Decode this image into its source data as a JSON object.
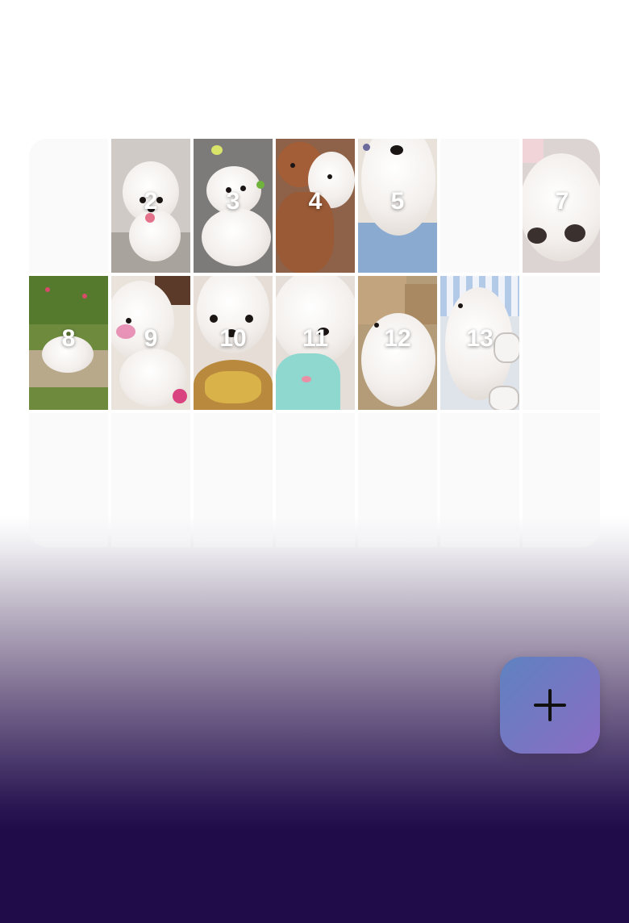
{
  "tiles": [
    {
      "label": "",
      "filled": false
    },
    {
      "label": "2",
      "filled": true
    },
    {
      "label": "3",
      "filled": true
    },
    {
      "label": "4",
      "filled": true
    },
    {
      "label": "5",
      "filled": true
    },
    {
      "label": "",
      "filled": false
    },
    {
      "label": "7",
      "filled": true
    },
    {
      "label": "8",
      "filled": true
    },
    {
      "label": "9",
      "filled": true
    },
    {
      "label": "10",
      "filled": true
    },
    {
      "label": "11",
      "filled": true
    },
    {
      "label": "12",
      "filled": true
    },
    {
      "label": "13",
      "filled": true
    },
    {
      "label": "",
      "filled": false
    },
    {
      "label": "",
      "filled": false
    },
    {
      "label": "",
      "filled": false
    },
    {
      "label": "",
      "filled": false
    },
    {
      "label": "",
      "filled": false
    },
    {
      "label": "",
      "filled": false
    },
    {
      "label": "",
      "filled": false
    },
    {
      "label": "",
      "filled": false
    }
  ],
  "add_button": {
    "icon": "plus-icon"
  },
  "colors": {
    "accent_start": "#5f82c0",
    "accent_end": "#8a6cc4",
    "bottom": "#1f0c48"
  }
}
